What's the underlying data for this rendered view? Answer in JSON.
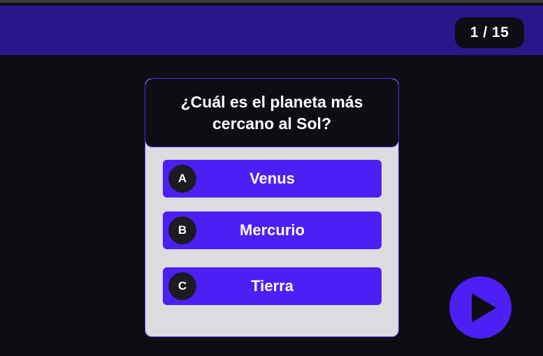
{
  "header": {
    "progress": "1 / 15",
    "color": "#2a1688"
  },
  "quiz": {
    "question": "¿Cuál es el planeta más cercano al Sol?",
    "options": [
      {
        "letter": "A",
        "label": "Venus"
      },
      {
        "letter": "B",
        "label": "Mercurio"
      },
      {
        "letter": "C",
        "label": "Tierra"
      }
    ]
  },
  "controls": {
    "next_icon": "play-icon"
  },
  "colors": {
    "accent": "#4c1ff5",
    "background": "#0e0d14",
    "card": "#dcdbdf"
  }
}
